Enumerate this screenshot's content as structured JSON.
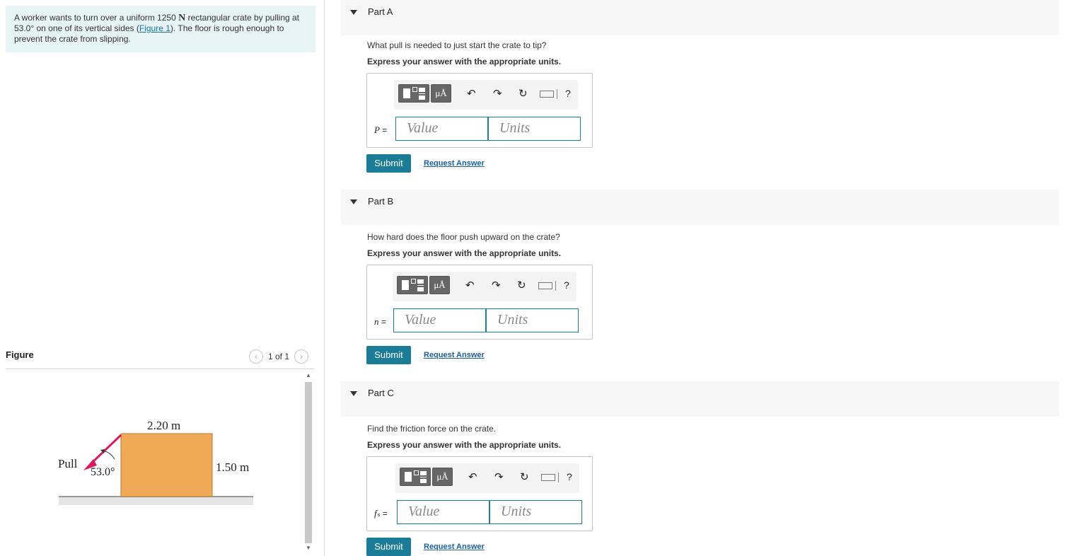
{
  "problem": {
    "text_before_unit": "A worker wants to turn over a uniform 1250 ",
    "unit": "N",
    "text_after_unit": " rectangular crate by pulling at",
    "text_line2_pre": "53.0° on one of its vertical sides (",
    "figure_link": "Figure 1",
    "text_line2_post": "). The floor is rough enough to",
    "text_line3": "prevent the crate from slipping."
  },
  "figure": {
    "title": "Figure",
    "pager_text": "1 of 1",
    "prev_icon": "chevron-left-icon",
    "next_icon": "chevron-right-icon",
    "labels": {
      "width": "2.20 m",
      "height": "1.50 m",
      "pull": "Pull",
      "angle": "53.0°"
    },
    "colors": {
      "crate": "#f0a957",
      "arrow": "#e0185a",
      "floor": "#c8c8c8"
    }
  },
  "parts": [
    {
      "title": "Part A",
      "question": "What pull is needed to just start the crate to tip?",
      "instruction": "Express your answer with the appropriate units.",
      "var_name": "P",
      "var_eq": " =",
      "value_placeholder": "Value",
      "units_placeholder": "Units",
      "submit": "Submit",
      "request": "Request Answer"
    },
    {
      "title": "Part B",
      "question": "How hard does the floor push upward on the crate?",
      "instruction": "Express your answer with the appropriate units.",
      "var_name": "n",
      "var_eq": " =",
      "value_placeholder": "Value",
      "units_placeholder": "Units",
      "submit": "Submit",
      "request": "Request Answer"
    },
    {
      "title": "Part C",
      "question": "Find the friction force on the crate.",
      "instruction": "Express your answer with the appropriate units.",
      "var_name": "fₛ",
      "var_eq": " =",
      "value_placeholder": "Value",
      "units_placeholder": "Units",
      "submit": "Submit",
      "request": "Request Answer"
    }
  ],
  "toolbar": {
    "mu_label": "μÅ",
    "undo": "↶",
    "redo": "↷",
    "reset": "↻",
    "help": "?",
    "icons": [
      "templates-icon",
      "units-symbols-icon",
      "undo-icon",
      "redo-icon",
      "reset-icon",
      "keyboard-icon",
      "help-icon"
    ]
  },
  "colors": {
    "accent": "#1b7c98",
    "link": "#1a5fa0",
    "problem_bg": "#e6f4f6",
    "header_bg": "#f7f7f7"
  }
}
